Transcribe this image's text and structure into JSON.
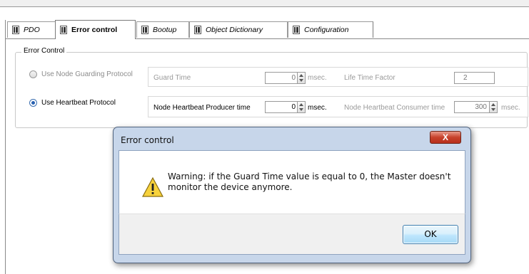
{
  "tabs": [
    {
      "label": "PDO",
      "active": false
    },
    {
      "label": "Error control",
      "active": true
    },
    {
      "label": "Bootup",
      "active": false
    },
    {
      "label": "Object Dictionary",
      "active": false
    },
    {
      "label": "Configuration",
      "active": false
    }
  ],
  "group": {
    "title": "Error Control",
    "node_guarding": {
      "label": "Use Node Guarding Protocol",
      "selected": false,
      "guard_time_label": "Guard Time",
      "guard_time_value": "0",
      "guard_time_unit": "msec.",
      "life_time_factor_label": "Life Time Factor",
      "life_time_factor_value": "2"
    },
    "heartbeat": {
      "label": "Use Heartbeat Protocol",
      "selected": true,
      "producer_label": "Node Heartbeat Producer time",
      "producer_value": "0",
      "producer_unit": "msec.",
      "consumer_label": "Node Heartbeat Consumer time",
      "consumer_value": "300",
      "consumer_unit": "msec."
    }
  },
  "dialog": {
    "title": "Error control",
    "close_label": "X",
    "message_line1": "Warning: if the Guard Time value is equal to 0, the Master doesn't",
    "message_line2": "monitor the device anymore.",
    "ok_label": "OK",
    "icon": "warning-icon"
  },
  "colors": {
    "accent": "#2760b0",
    "close_button": "#c7412b",
    "dialog_frame": "#c7d6ea"
  }
}
